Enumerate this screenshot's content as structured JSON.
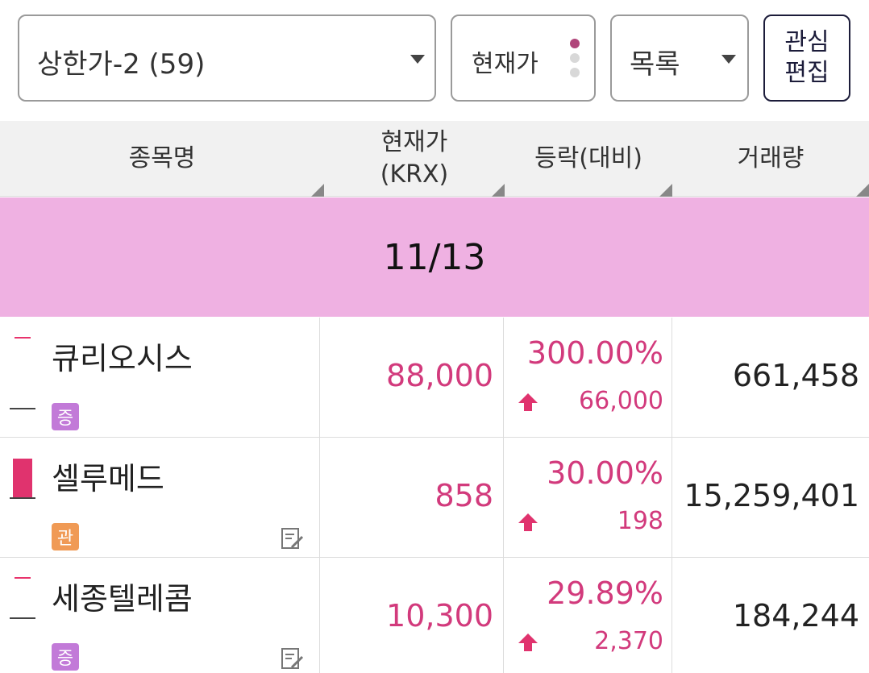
{
  "toolbar": {
    "group_select": "상한가-2 (59)",
    "price_select": "현재가",
    "view_select": "목록",
    "edit_button": "관심\n편집"
  },
  "columns": {
    "name": "종목명",
    "price": "현재가\n(KRX)",
    "change": "등락(대비)",
    "volume": "거래량"
  },
  "date_band": "11/13",
  "rows": [
    {
      "name": "큐리오시스",
      "badge": "증",
      "price": "88,000",
      "change_pct": "300.00%",
      "change_amt": "66,000",
      "volume": "661,458"
    },
    {
      "name": "셀루메드",
      "badge": "관",
      "price": "858",
      "change_pct": "30.00%",
      "change_amt": "198",
      "volume": "15,259,401"
    },
    {
      "name": "세종텔레콤",
      "badge": "증",
      "price": "10,300",
      "change_pct": "29.89%",
      "change_amt": "2,370",
      "volume": "184,244"
    }
  ],
  "colors": {
    "accent_up": "#d23a7c",
    "date_band": "#efb1e2",
    "badge_jeung": "#c27ad8",
    "badge_gwan": "#f09a55"
  }
}
